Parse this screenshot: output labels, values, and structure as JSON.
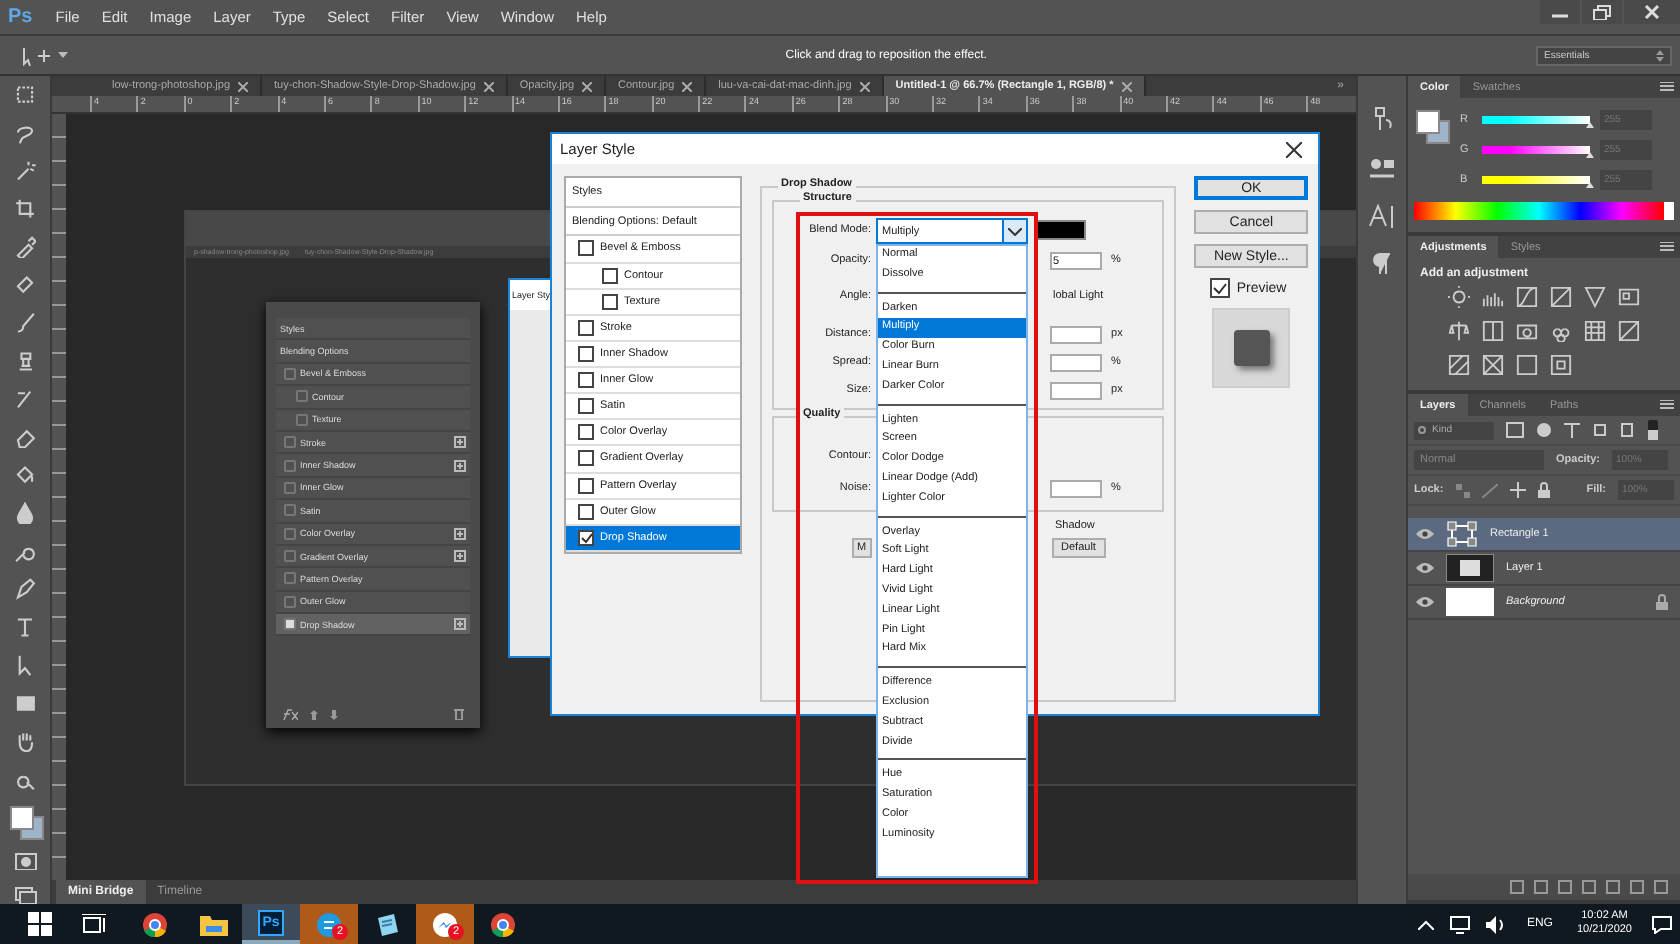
{
  "menu_bar": {
    "logo": "Ps",
    "items": [
      "File",
      "Edit",
      "Image",
      "Layer",
      "Type",
      "Select",
      "Filter",
      "View",
      "Window",
      "Help"
    ]
  },
  "options_bar": {
    "hint": "Click and drag to reposition the effect.",
    "workspace": "Essentials"
  },
  "document_tabs": [
    {
      "label": "low-trong-photoshop.jpg",
      "selected": false
    },
    {
      "label": "tuy-chon-Shadow-Style-Drop-Shadow.jpg",
      "selected": false
    },
    {
      "label": "Opacity.jpg",
      "selected": false
    },
    {
      "label": "Contour.jpg",
      "selected": false
    },
    {
      "label": "luu-va-cai-dat-mac-dinh.jpg",
      "selected": false
    },
    {
      "label": "Untitled-1 @ 66.7% (Rectangle 1, RGB/8) *",
      "selected": true
    }
  ],
  "tab_overflow": "»",
  "ruler": [
    "4",
    "2",
    "0",
    "2",
    "4",
    "6",
    "8",
    "10",
    "12",
    "14",
    "16",
    "18",
    "20",
    "22",
    "24",
    "26",
    "28",
    "30",
    "32",
    "34",
    "36",
    "38",
    "40",
    "42",
    "44",
    "46",
    "48"
  ],
  "canvas_document": {
    "tabs": [
      "p-shadow-trong-photoshop.jpg",
      "tuy-chon-Shadow-Style-Drop-Shadow.jpg"
    ],
    "small_dialog_title": "Layer Sty",
    "panel": {
      "headers": [
        "Styles",
        "Blending Options"
      ],
      "effects": [
        {
          "label": "Bevel & Emboss",
          "checked": false,
          "plus": false,
          "selected": false,
          "children": [
            {
              "label": "Contour",
              "checked": false,
              "plus": false,
              "selected": false
            },
            {
              "label": "Texture",
              "checked": false,
              "plus": false,
              "selected": false
            }
          ]
        },
        {
          "label": "Stroke",
          "checked": false,
          "plus": true,
          "selected": false
        },
        {
          "label": "Inner Shadow",
          "checked": false,
          "plus": true,
          "selected": false
        },
        {
          "label": "Inner Glow",
          "checked": false,
          "plus": false,
          "selected": false
        },
        {
          "label": "Satin",
          "checked": false,
          "plus": false,
          "selected": false
        },
        {
          "label": "Color Overlay",
          "checked": false,
          "plus": true,
          "selected": false
        },
        {
          "label": "Gradient Overlay",
          "checked": false,
          "plus": true,
          "selected": false
        },
        {
          "label": "Pattern Overlay",
          "checked": false,
          "plus": false,
          "selected": false
        },
        {
          "label": "Outer Glow",
          "checked": false,
          "plus": false,
          "selected": false
        },
        {
          "label": "Drop Shadow",
          "checked": true,
          "plus": true,
          "selected": true
        }
      ]
    }
  },
  "bottom_tabs": [
    {
      "label": "Mini Bridge",
      "selected": true
    },
    {
      "label": "Timeline",
      "selected": false
    }
  ],
  "dialog": {
    "title": "Layer Style",
    "styles_header": "Styles",
    "blending": "Blending Options: Default",
    "effects": [
      {
        "label": "Bevel & Emboss",
        "checked": false,
        "selected": false,
        "children": [
          {
            "label": "Contour",
            "checked": false,
            "selected": false
          },
          {
            "label": "Texture",
            "checked": false,
            "selected": false
          }
        ]
      },
      {
        "label": "Stroke",
        "checked": false,
        "selected": false
      },
      {
        "label": "Inner Shadow",
        "checked": false,
        "selected": false
      },
      {
        "label": "Inner Glow",
        "checked": false,
        "selected": false
      },
      {
        "label": "Satin",
        "checked": false,
        "selected": false
      },
      {
        "label": "Color Overlay",
        "checked": false,
        "selected": false
      },
      {
        "label": "Gradient Overlay",
        "checked": false,
        "selected": false
      },
      {
        "label": "Pattern Overlay",
        "checked": false,
        "selected": false
      },
      {
        "label": "Outer Glow",
        "checked": false,
        "selected": false
      },
      {
        "label": "Drop Shadow",
        "checked": true,
        "selected": true
      }
    ],
    "group_title": "Drop Shadow",
    "structure_title": "Structure",
    "blend_mode_label": "Blend Mode:",
    "blend_mode": "Multiply",
    "fields": [
      {
        "label": "Opacity:",
        "value": "5",
        "unit": "%"
      },
      {
        "label": "Angle:",
        "suffix": "lobal Light"
      },
      {
        "label": "Distance:",
        "unit": "px"
      },
      {
        "label": "Spread:",
        "unit": "%"
      },
      {
        "label": "Size:",
        "unit": "px"
      }
    ],
    "quality_title": "Quality",
    "quality_fields": [
      {
        "label": "Contour:"
      },
      {
        "label": "Noise:",
        "unit": "%"
      }
    ],
    "knockout_text": "Shadow",
    "make_default": "M",
    "reset_default": "Default",
    "buttons": [
      {
        "label": "OK",
        "default": true
      },
      {
        "label": "Cancel",
        "default": false
      },
      {
        "label": "New Style...",
        "default": false
      }
    ],
    "preview": {
      "label": "Preview",
      "checked": true
    },
    "blend_modes": [
      [
        {
          "label": "Normal",
          "selected": false
        },
        {
          "label": "Dissolve",
          "selected": false
        }
      ],
      [
        {
          "label": "Darken",
          "selected": false
        },
        {
          "label": "Multiply",
          "selected": true
        },
        {
          "label": "Color Burn",
          "selected": false
        },
        {
          "label": "Linear Burn",
          "selected": false
        },
        {
          "label": "Darker Color",
          "selected": false
        }
      ],
      [
        {
          "label": "Lighten",
          "selected": false
        },
        {
          "label": "Screen",
          "selected": false
        },
        {
          "label": "Color Dodge",
          "selected": false
        },
        {
          "label": "Linear Dodge (Add)",
          "selected": false
        },
        {
          "label": "Lighter Color",
          "selected": false
        }
      ],
      [
        {
          "label": "Overlay",
          "selected": false
        },
        {
          "label": "Soft Light",
          "selected": false
        },
        {
          "label": "Hard Light",
          "selected": false
        },
        {
          "label": "Vivid Light",
          "selected": false
        },
        {
          "label": "Linear Light",
          "selected": false
        },
        {
          "label": "Pin Light",
          "selected": false
        },
        {
          "label": "Hard Mix",
          "selected": false
        }
      ],
      [
        {
          "label": "Difference",
          "selected": false
        },
        {
          "label": "Exclusion",
          "selected": false
        },
        {
          "label": "Subtract",
          "selected": false
        },
        {
          "label": "Divide",
          "selected": false
        }
      ],
      [
        {
          "label": "Hue",
          "selected": false
        },
        {
          "label": "Saturation",
          "selected": false
        },
        {
          "label": "Color",
          "selected": false
        },
        {
          "label": "Luminosity",
          "selected": false
        }
      ]
    ]
  },
  "panels": {
    "color": {
      "tabs": [
        {
          "label": "Color",
          "selected": true
        },
        {
          "label": "Swatches",
          "selected": false
        }
      ],
      "channels": [
        {
          "name": "R",
          "color": "#00ffff",
          "level": 1,
          "value": "255"
        },
        {
          "name": "G",
          "color": "#ff00ff",
          "level": 1,
          "value": "255"
        },
        {
          "name": "B",
          "color": "#ffff00",
          "level": 1,
          "value": "255"
        }
      ]
    },
    "adjustments": {
      "tabs": [
        {
          "label": "Adjustments",
          "selected": true
        },
        {
          "label": "Styles",
          "selected": false
        }
      ],
      "title": "Add an adjustment"
    },
    "layers": {
      "tabs": [
        {
          "label": "Layers",
          "selected": true
        },
        {
          "label": "Channels",
          "selected": false
        },
        {
          "label": "Paths",
          "selected": false
        }
      ],
      "filter": "Kind",
      "blend_mode": "Normal",
      "opacity_label": "Opacity:",
      "opacity": "100%",
      "lock_label": "Lock:",
      "fill_label": "Fill:",
      "fill": "100%",
      "items": [
        {
          "name": "Rectangle 1",
          "kind": "shape",
          "selected": true
        },
        {
          "name": "Layer 1",
          "kind": "image",
          "selected": false
        },
        {
          "name": "Background",
          "kind": "background",
          "selected": false
        }
      ]
    }
  },
  "taskbar": {
    "apps": [
      {
        "kind": "browser",
        "active": false,
        "flashing": false
      },
      {
        "kind": "folder",
        "active": false,
        "flashing": false
      },
      {
        "kind": "ps",
        "label": "Ps",
        "active": true,
        "flashing": false
      },
      {
        "kind": "chat",
        "badge": "2",
        "active": false,
        "flashing": true
      },
      {
        "kind": "notes",
        "active": false,
        "flashing": false
      },
      {
        "kind": "messenger",
        "badge": "2",
        "active": false,
        "flashing": true
      },
      {
        "kind": "browser",
        "active": false,
        "flashing": false
      }
    ],
    "language": "ENG",
    "time": "10:02 AM",
    "date": "10/21/2020"
  }
}
